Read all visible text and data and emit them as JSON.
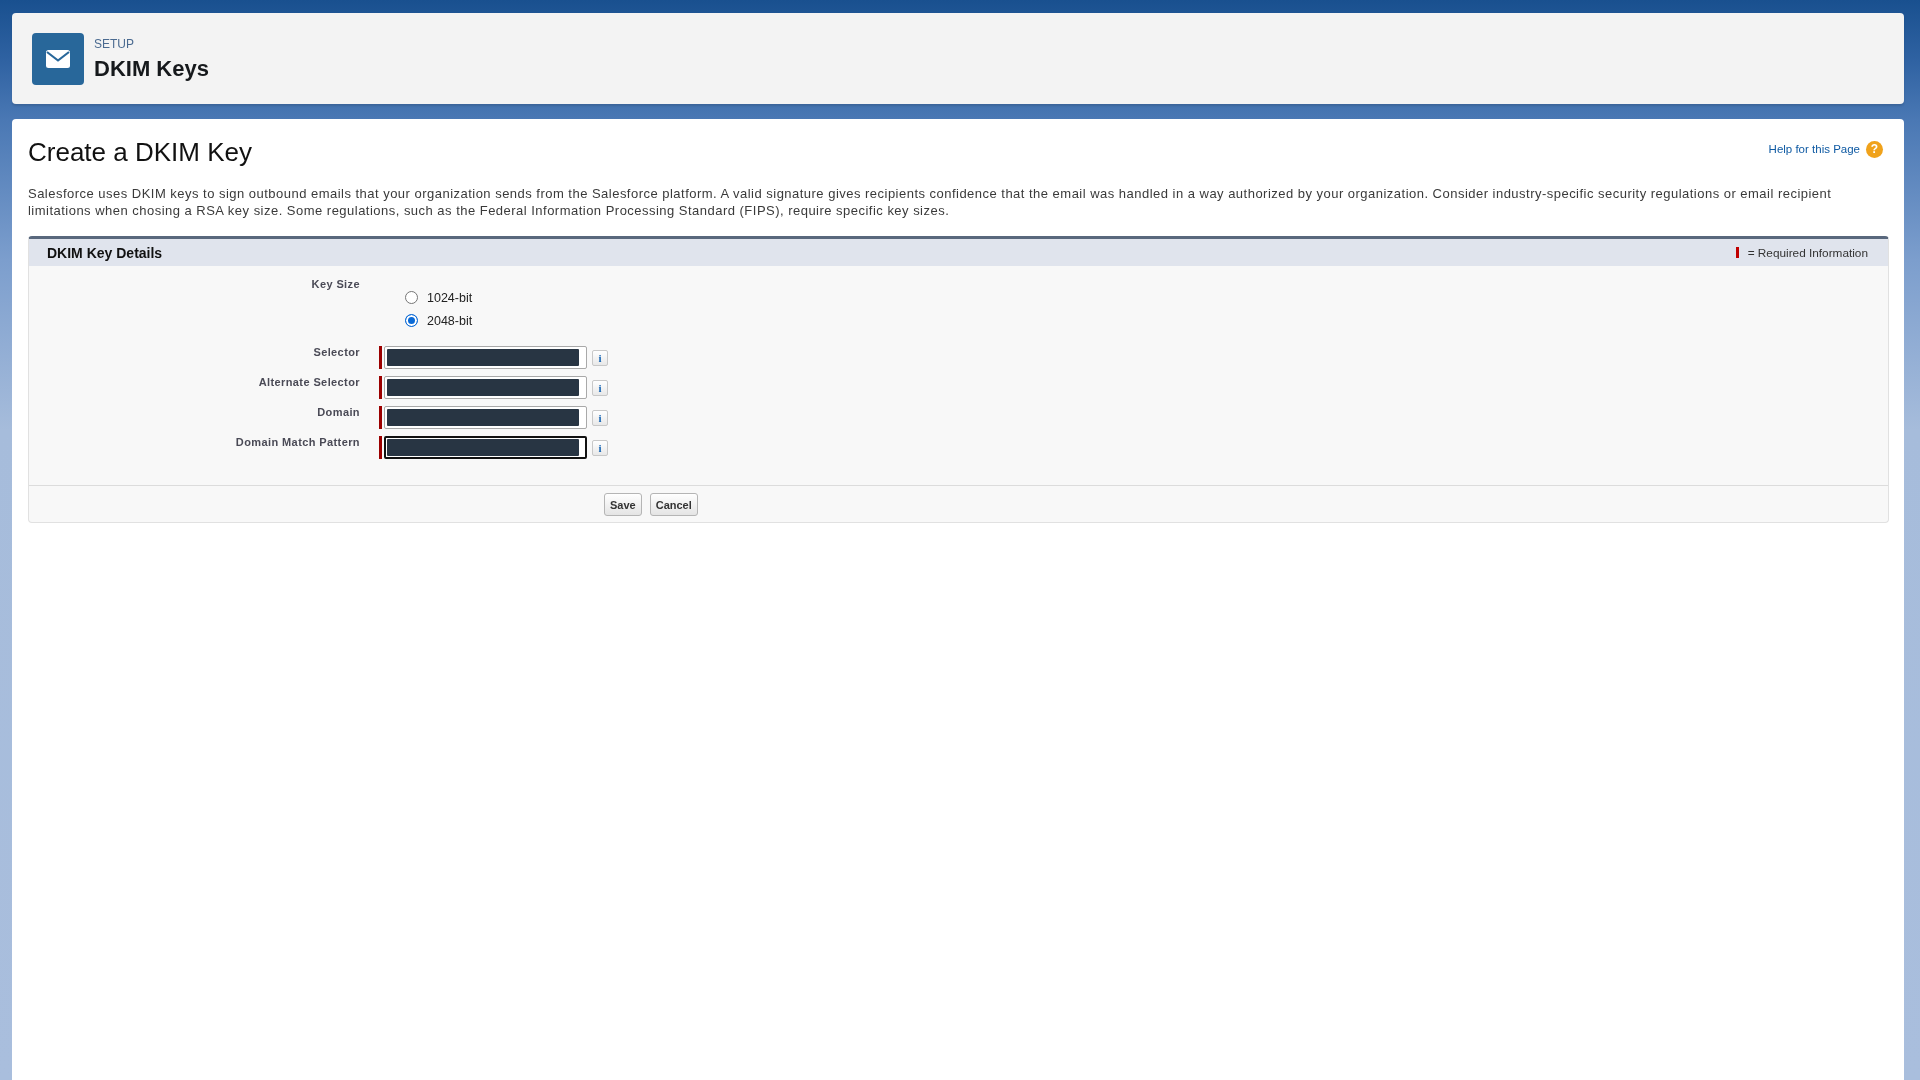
{
  "header": {
    "breadcrumb": "SETUP",
    "title": "DKIM Keys"
  },
  "page": {
    "title": "Create a DKIM Key",
    "help_link": "Help for this Page",
    "help_icon": "?",
    "description": "Salesforce uses DKIM keys to sign outbound emails that your organization sends from the Salesforce platform. A valid signature gives recipients confidence that the email was handled in a way authorized by your organization. Consider industry-specific security regulations or email recipient limitations when chosing a RSA key size. Some regulations, such as the Federal Information Processing Standard (FIPS), require specific key sizes."
  },
  "section": {
    "title": "DKIM Key Details",
    "required_legend": "= Required Information",
    "key_size": {
      "label": "Key Size",
      "options": [
        {
          "label": "1024-bit",
          "selected": false
        },
        {
          "label": "2048-bit",
          "selected": true
        }
      ]
    },
    "fields": [
      {
        "label": "Selector",
        "required": true,
        "redacted": true,
        "focused": false,
        "info": "i"
      },
      {
        "label": "Alternate Selector",
        "required": true,
        "redacted": true,
        "focused": false,
        "info": "i"
      },
      {
        "label": "Domain",
        "required": true,
        "redacted": true,
        "focused": false,
        "info": "i"
      },
      {
        "label": "Domain Match Pattern",
        "required": true,
        "redacted": true,
        "focused": true,
        "info": "i"
      }
    ]
  },
  "buttons": [
    "Save",
    "Cancel"
  ]
}
